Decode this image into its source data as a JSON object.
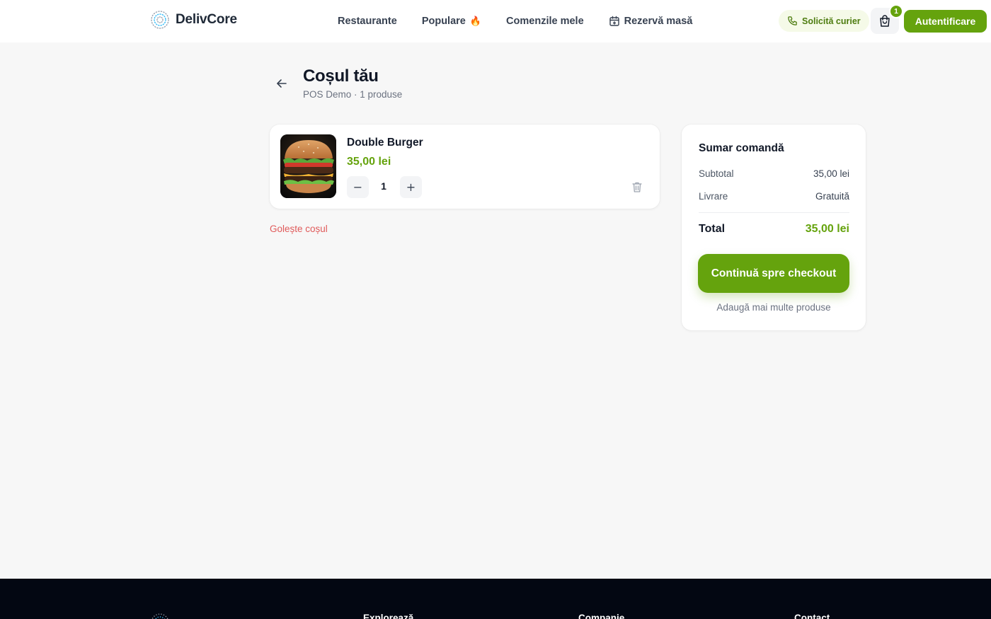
{
  "header": {
    "brand": "DelivCore",
    "nav": [
      {
        "label": "Restaurante"
      },
      {
        "label": "Populare",
        "emoji": "🔥"
      },
      {
        "label": "Comenzile mele"
      },
      {
        "label": "Rezervă masă",
        "icon": "calendar-icon"
      }
    ],
    "courier_label": "Solicită curier",
    "cart_count": "1",
    "login_label": "Autentificare"
  },
  "page": {
    "title": "Coșul tău",
    "subtitle": "POS Demo · 1 produse"
  },
  "cart": {
    "items": [
      {
        "name": "Double Burger",
        "price": "35,00 lei",
        "quantity": "1",
        "minus": "−",
        "plus": "+"
      }
    ],
    "clear_label": "Golește coșul"
  },
  "summary": {
    "title": "Sumar comandă",
    "subtotal_label": "Subtotal",
    "subtotal_value": "35,00 lei",
    "delivery_label": "Livrare",
    "delivery_value": "Gratuită",
    "total_label": "Total",
    "total_value": "35,00 lei",
    "checkout_label": "Continuă spre checkout",
    "add_more_label": "Adaugă mai multe produse"
  },
  "footer": {
    "headings": [
      "Explorează",
      "Companie",
      "Contact"
    ]
  },
  "colors": {
    "accent": "#65a30d",
    "danger": "#e05a5a",
    "footer_bg": "#030712",
    "page_bg": "#f7f7f7"
  }
}
